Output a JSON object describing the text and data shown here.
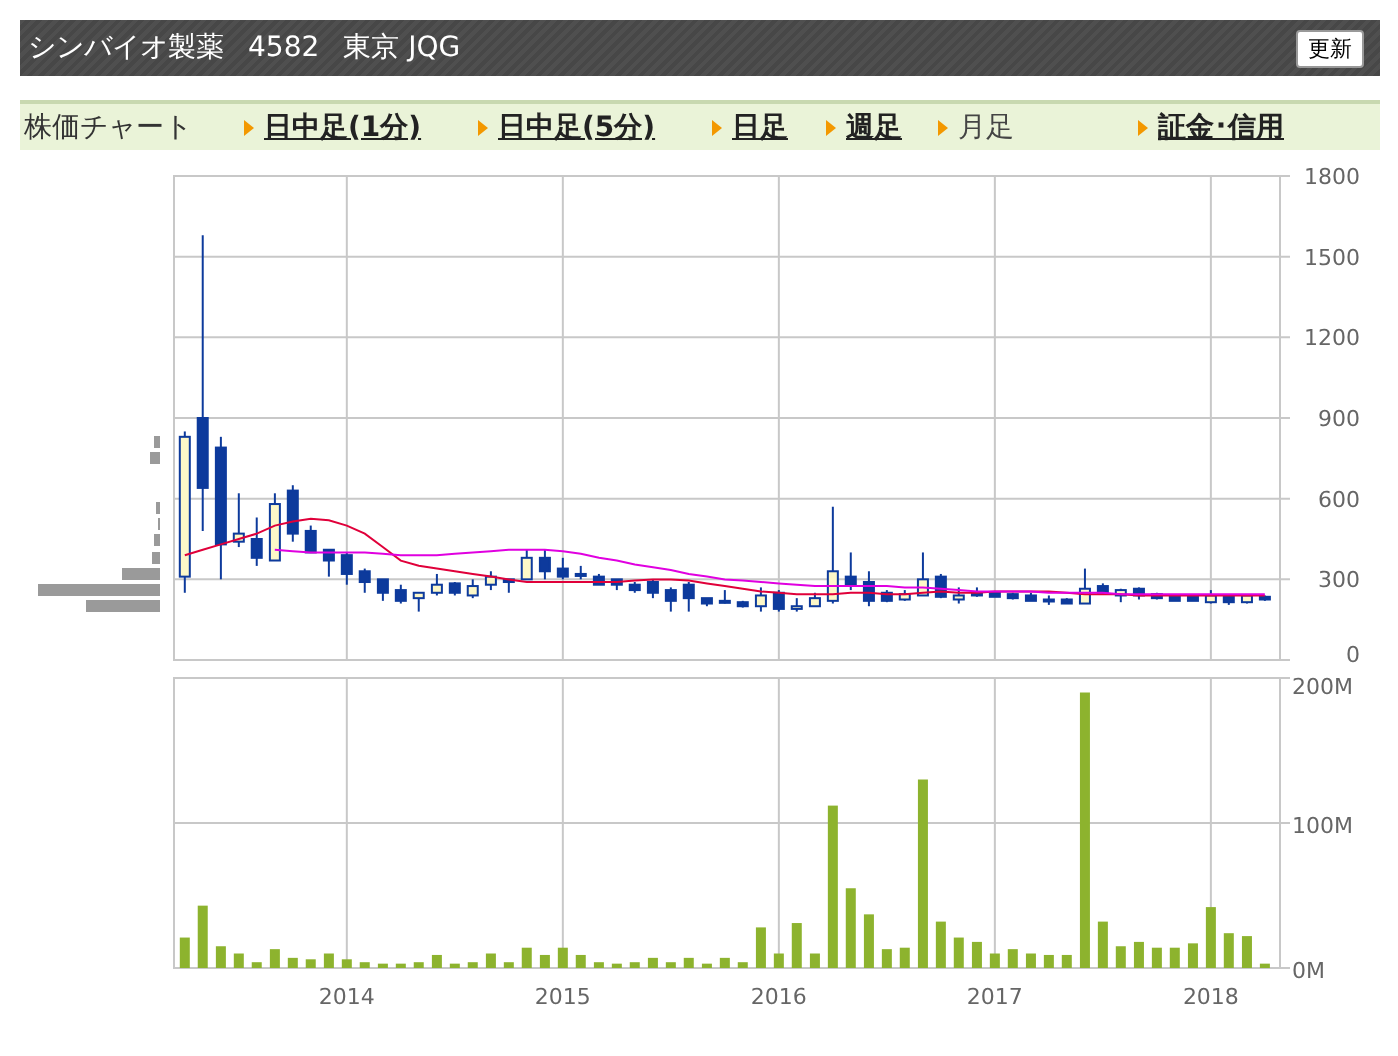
{
  "header": {
    "company": "シンバイオ製薬",
    "code": "4582",
    "market": "東京 JQG",
    "refresh_button": "更新"
  },
  "nav": {
    "label": "株価チャート",
    "items": [
      {
        "label": "日中足(1分)",
        "selected": false
      },
      {
        "label": "日中足(5分)",
        "selected": false
      },
      {
        "label": "日足",
        "selected": false
      },
      {
        "label": "週足",
        "selected": false
      },
      {
        "label": "月足",
        "selected": true
      },
      {
        "label": "証金･信用",
        "selected": false
      }
    ]
  },
  "price_chart": {
    "candles": {
      "chart_data": {
        "type": "candlestick",
        "ohlc": [
          [
            310,
            850,
            250,
            830
          ],
          [
            900,
            1580,
            480,
            640
          ],
          [
            790,
            830,
            300,
            430
          ],
          [
            440,
            620,
            420,
            470
          ],
          [
            450,
            530,
            350,
            380
          ],
          [
            370,
            620,
            370,
            580
          ],
          [
            630,
            650,
            440,
            470
          ],
          [
            480,
            500,
            400,
            400
          ],
          [
            410,
            410,
            310,
            370
          ],
          [
            390,
            400,
            280,
            320
          ],
          [
            330,
            340,
            250,
            290
          ],
          [
            300,
            300,
            220,
            250
          ],
          [
            260,
            280,
            210,
            220
          ],
          [
            230,
            250,
            180,
            250
          ],
          [
            250,
            320,
            240,
            280
          ],
          [
            285,
            290,
            240,
            250
          ],
          [
            240,
            300,
            230,
            275
          ],
          [
            280,
            330,
            260,
            310
          ],
          [
            300,
            300,
            250,
            290
          ],
          [
            300,
            410,
            300,
            380
          ],
          [
            380,
            410,
            300,
            330
          ],
          [
            340,
            380,
            300,
            310
          ],
          [
            320,
            350,
            300,
            315
          ],
          [
            310,
            320,
            280,
            280
          ],
          [
            300,
            300,
            260,
            280
          ],
          [
            280,
            290,
            250,
            260
          ],
          [
            290,
            300,
            230,
            250
          ],
          [
            260,
            270,
            180,
            220
          ],
          [
            280,
            290,
            180,
            230
          ],
          [
            230,
            230,
            200,
            210
          ],
          [
            220,
            260,
            210,
            215
          ],
          [
            215,
            220,
            195,
            200
          ],
          [
            200,
            270,
            180,
            240
          ],
          [
            250,
            260,
            180,
            190
          ],
          [
            190,
            230,
            180,
            200
          ],
          [
            200,
            250,
            200,
            230
          ],
          [
            220,
            570,
            210,
            330
          ],
          [
            310,
            400,
            260,
            280
          ],
          [
            290,
            330,
            200,
            220
          ],
          [
            250,
            260,
            215,
            220
          ],
          [
            225,
            260,
            220,
            245
          ],
          [
            240,
            400,
            240,
            300
          ],
          [
            310,
            320,
            230,
            235
          ],
          [
            225,
            270,
            210,
            240
          ],
          [
            250,
            270,
            235,
            240
          ],
          [
            250,
            255,
            235,
            235
          ],
          [
            245,
            250,
            225,
            230
          ],
          [
            240,
            250,
            220,
            220
          ],
          [
            225,
            240,
            205,
            225
          ],
          [
            225,
            230,
            210,
            210
          ],
          [
            210,
            340,
            210,
            265
          ],
          [
            275,
            285,
            245,
            250
          ],
          [
            240,
            265,
            215,
            260
          ],
          [
            265,
            270,
            225,
            240
          ],
          [
            245,
            250,
            225,
            230
          ],
          [
            240,
            245,
            220,
            220
          ],
          [
            235,
            240,
            220,
            220
          ],
          [
            215,
            260,
            210,
            240
          ],
          [
            235,
            240,
            205,
            215
          ],
          [
            215,
            245,
            210,
            240
          ],
          [
            235,
            240,
            220,
            225
          ]
        ],
        "x": [
          2013.25,
          2013.333,
          2013.417,
          2013.5,
          2013.583,
          2013.667,
          2013.75,
          2013.833,
          2013.917,
          2014,
          2014.083,
          2014.167,
          2014.25,
          2014.333,
          2014.417,
          2014.5,
          2014.583,
          2014.667,
          2014.75,
          2014.833,
          2014.917,
          2015,
          2015.083,
          2015.167,
          2015.25,
          2015.333,
          2015.417,
          2015.5,
          2015.583,
          2015.667,
          2015.75,
          2015.833,
          2015.917,
          2016,
          2016.083,
          2016.167,
          2016.25,
          2016.333,
          2016.417,
          2016.5,
          2016.583,
          2016.667,
          2016.75,
          2016.833,
          2016.917,
          2017,
          2017.083,
          2017.167,
          2017.25,
          2017.333,
          2017.417,
          2017.5,
          2017.583,
          2017.667,
          2017.75,
          2017.833,
          2017.917,
          2018,
          2018.083,
          2018.167,
          2018.25
        ],
        "xlim": [
          2013.2,
          2018.32
        ],
        "ylim": [
          0,
          1800
        ],
        "yticks": [
          0,
          300,
          600,
          900,
          1200,
          1500,
          1800
        ],
        "grid": true
      }
    },
    "moving_averages": {
      "chart_data": {
        "type": "line",
        "x": [
          2013.25,
          2013.333,
          2013.417,
          2013.5,
          2013.583,
          2013.667,
          2013.75,
          2013.833,
          2013.917,
          2014,
          2014.083,
          2014.167,
          2014.25,
          2014.333,
          2014.417,
          2014.5,
          2014.583,
          2014.667,
          2014.75,
          2014.833,
          2014.917,
          2015,
          2015.083,
          2015.167,
          2015.25,
          2015.333,
          2015.417,
          2015.5,
          2015.583,
          2015.667,
          2015.75,
          2015.833,
          2015.917,
          2016,
          2016.083,
          2016.167,
          2016.25,
          2016.333,
          2016.417,
          2016.5,
          2016.583,
          2016.667,
          2016.75,
          2016.833,
          2016.917,
          2017,
          2017.083,
          2017.167,
          2017.25,
          2017.333,
          2017.417,
          2017.5,
          2017.583,
          2017.667,
          2017.75,
          2017.833,
          2017.917,
          2018,
          2018.083,
          2018.167,
          2018.25
        ],
        "series": [
          {
            "color": "#e0003a",
            "values": [
              390,
              410,
              430,
              450,
              470,
              500,
              515,
              525,
              520,
              500,
              470,
              420,
              370,
              350,
              340,
              330,
              320,
              310,
              300,
              290,
              290,
              290,
              290,
              290,
              290,
              295,
              300,
              300,
              295,
              285,
              275,
              265,
              255,
              250,
              245,
              245,
              245,
              250,
              250,
              245,
              245,
              250,
              255,
              250,
              250,
              255,
              255,
              255,
              255,
              250,
              245,
              245,
              245,
              240,
              240,
              240,
              240,
              240,
              240,
              240,
              240
            ]
          },
          {
            "color": "#e000e0",
            "values": [
              null,
              null,
              null,
              null,
              null,
              410,
              405,
              400,
              400,
              400,
              400,
              395,
              390,
              390,
              390,
              395,
              400,
              405,
              410,
              410,
              410,
              405,
              395,
              380,
              370,
              355,
              345,
              335,
              320,
              310,
              300,
              295,
              290,
              285,
              280,
              275,
              275,
              275,
              275,
              275,
              270,
              270,
              265,
              260,
              255,
              255,
              255,
              255,
              250,
              250,
              250,
              250,
              245,
              245,
              245,
              245,
              245,
              245,
              245,
              245,
              245
            ]
          }
        ],
        "xlim": [
          2013.2,
          2018.32
        ],
        "ylim": [
          0,
          1800
        ]
      }
    }
  },
  "volume_chart": {
    "chart_data": {
      "type": "bar",
      "x": [
        2013.25,
        2013.333,
        2013.417,
        2013.5,
        2013.583,
        2013.667,
        2013.75,
        2013.833,
        2013.917,
        2014,
        2014.083,
        2014.167,
        2014.25,
        2014.333,
        2014.417,
        2014.5,
        2014.583,
        2014.667,
        2014.75,
        2014.833,
        2014.917,
        2015,
        2015.083,
        2015.167,
        2015.25,
        2015.333,
        2015.417,
        2015.5,
        2015.583,
        2015.667,
        2015.75,
        2015.833,
        2015.917,
        2016,
        2016.083,
        2016.167,
        2016.25,
        2016.333,
        2016.417,
        2016.5,
        2016.583,
        2016.667,
        2016.75,
        2016.833,
        2016.917,
        2017,
        2017.083,
        2017.167,
        2017.25,
        2017.333,
        2017.417,
        2017.5,
        2017.583,
        2017.667,
        2017.75,
        2017.833,
        2017.917,
        2018,
        2018.083,
        2018.167,
        2018.25
      ],
      "series": [
        {
          "color": "#8db32e",
          "values": [
            21,
            43,
            15,
            10,
            4,
            13,
            7,
            6,
            10,
            6,
            4,
            3,
            3,
            4,
            9,
            3,
            4,
            10,
            4,
            14,
            9,
            14,
            9,
            4,
            3,
            4,
            7,
            4,
            7,
            3,
            7,
            4,
            28,
            10,
            31,
            10,
            112,
            55,
            37,
            13,
            14,
            130,
            32,
            21,
            18,
            10,
            13,
            10,
            9,
            9,
            190,
            32,
            15,
            18,
            14,
            14,
            17,
            42,
            24,
            22,
            3
          ]
        }
      ],
      "xlim": [
        2013.2,
        2018.32
      ],
      "ylim": [
        0,
        200
      ],
      "yticks": [
        {
          "value": 0,
          "label": "0M"
        },
        {
          "value": 100,
          "label": "100M"
        },
        {
          "value": 200,
          "label": "200M"
        }
      ],
      "xticks": [
        2014,
        2015,
        2016,
        2017,
        2018
      ],
      "grid": true
    }
  }
}
